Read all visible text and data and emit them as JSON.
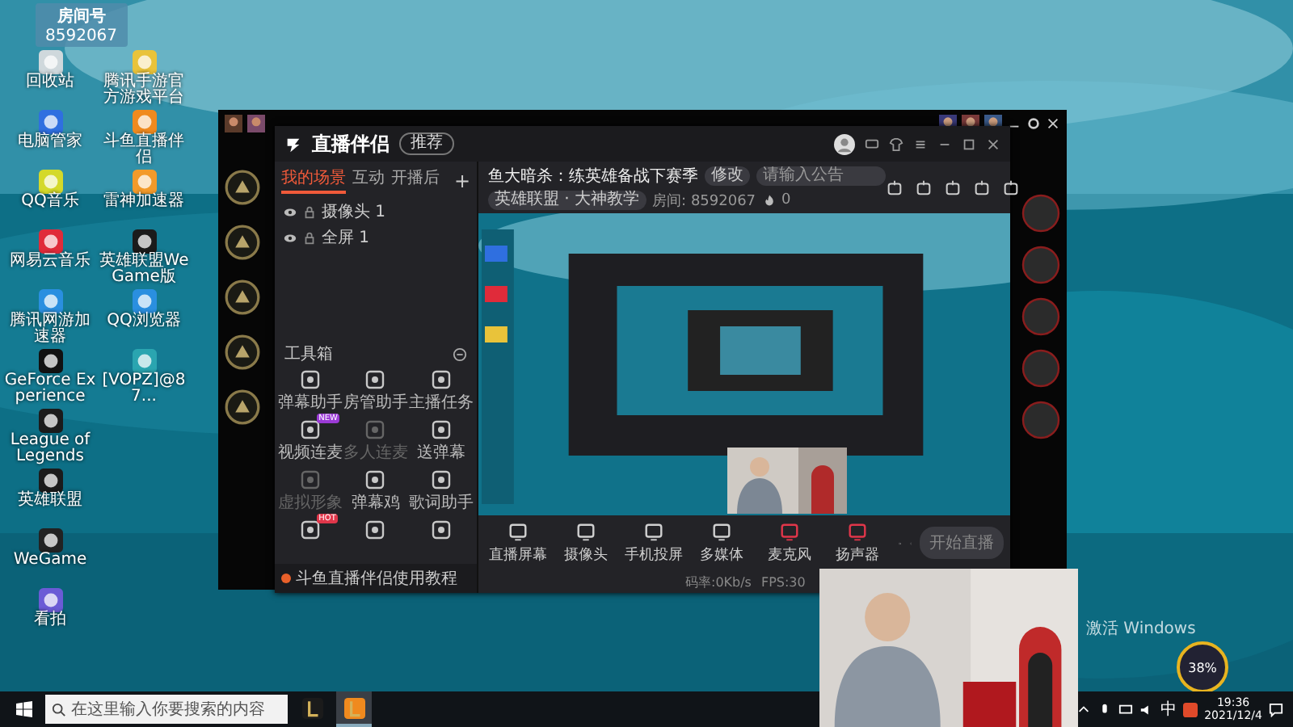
{
  "desktop": {
    "room_badge": {
      "label": "房间号",
      "number": "8592067"
    },
    "icon_columns": [
      [
        {
          "label": "回收站"
        },
        {
          "label": "电脑管家"
        },
        {
          "label": "QQ音乐"
        },
        {
          "label": "网易云音乐"
        },
        {
          "label": "腾讯网游加速器"
        },
        {
          "label": "GeForce Experience"
        },
        {
          "label": "League of Legends"
        },
        {
          "label": "英雄联盟"
        },
        {
          "label": "WeGame"
        },
        {
          "label": "看拍"
        }
      ],
      [
        {
          "label": "腾讯手游官方游戏平台"
        },
        {
          "label": "斗鱼直播伴侣"
        },
        {
          "label": "雷神加速器"
        },
        {
          "label": "英雄联盟WeGame版"
        },
        {
          "label": "QQ浏览器"
        },
        {
          "label": "[VOPZ]@87..."
        }
      ]
    ]
  },
  "streaming_app": {
    "logo": "直播伴侣",
    "badge": "推荐",
    "scene_tabs": [
      {
        "label": "我的场景",
        "selected": true
      },
      {
        "label": "互动",
        "selected": false
      },
      {
        "label": "开播后",
        "selected": false
      }
    ],
    "add_scene": "+",
    "sources": [
      {
        "label": "摄像头 1"
      },
      {
        "label": "全屏 1"
      }
    ],
    "toolbox_title": "工具箱",
    "tools": [
      {
        "label": "弹幕助手",
        "disabled": false
      },
      {
        "label": "房管助手",
        "disabled": false
      },
      {
        "label": "主播任务",
        "disabled": false
      },
      {
        "label": "视频连麦",
        "disabled": false,
        "badge": "NEW"
      },
      {
        "label": "多人连麦",
        "disabled": true
      },
      {
        "label": "送弹幕",
        "disabled": false
      },
      {
        "label": "虚拟形象",
        "disabled": true
      },
      {
        "label": "弹幕鸡",
        "disabled": false
      },
      {
        "label": "歌词助手",
        "disabled": false
      },
      {
        "disabled": false,
        "badge": "HOT"
      },
      {
        "disabled": false
      },
      {
        "disabled": false
      }
    ],
    "tutorial": "斗鱼直播伴侣使用教程",
    "stream_title": "鱼大暗杀：练英雄备战下赛季",
    "edit_tag": "修改",
    "notice_placeholder": "请输入公告",
    "category": "英雄联盟 · 大神教学",
    "room": "房间: 8592067",
    "heat": "0",
    "controls": [
      {
        "label": "直播屏幕",
        "on": false
      },
      {
        "label": "摄像头",
        "on": false
      },
      {
        "label": "手机投屏",
        "on": false
      },
      {
        "label": "多媒体",
        "on": false
      },
      {
        "label": "麦克风",
        "on": true
      },
      {
        "label": "扬声器",
        "on": true
      }
    ],
    "start_button": {
      "label": "开始直播",
      "disabled": true
    },
    "status": [
      "码率:0Kb/s",
      "FPS:30"
    ]
  },
  "activation_notice": "激活 Windows",
  "monitor": {
    "cpu": "38%"
  },
  "taskbar": {
    "search_placeholder": "在这里输入你要搜索的内容",
    "apps": [
      {
        "active": false
      },
      {
        "active": true
      }
    ],
    "ime": "中",
    "time": "19:36",
    "date": "2021/12/4"
  }
}
